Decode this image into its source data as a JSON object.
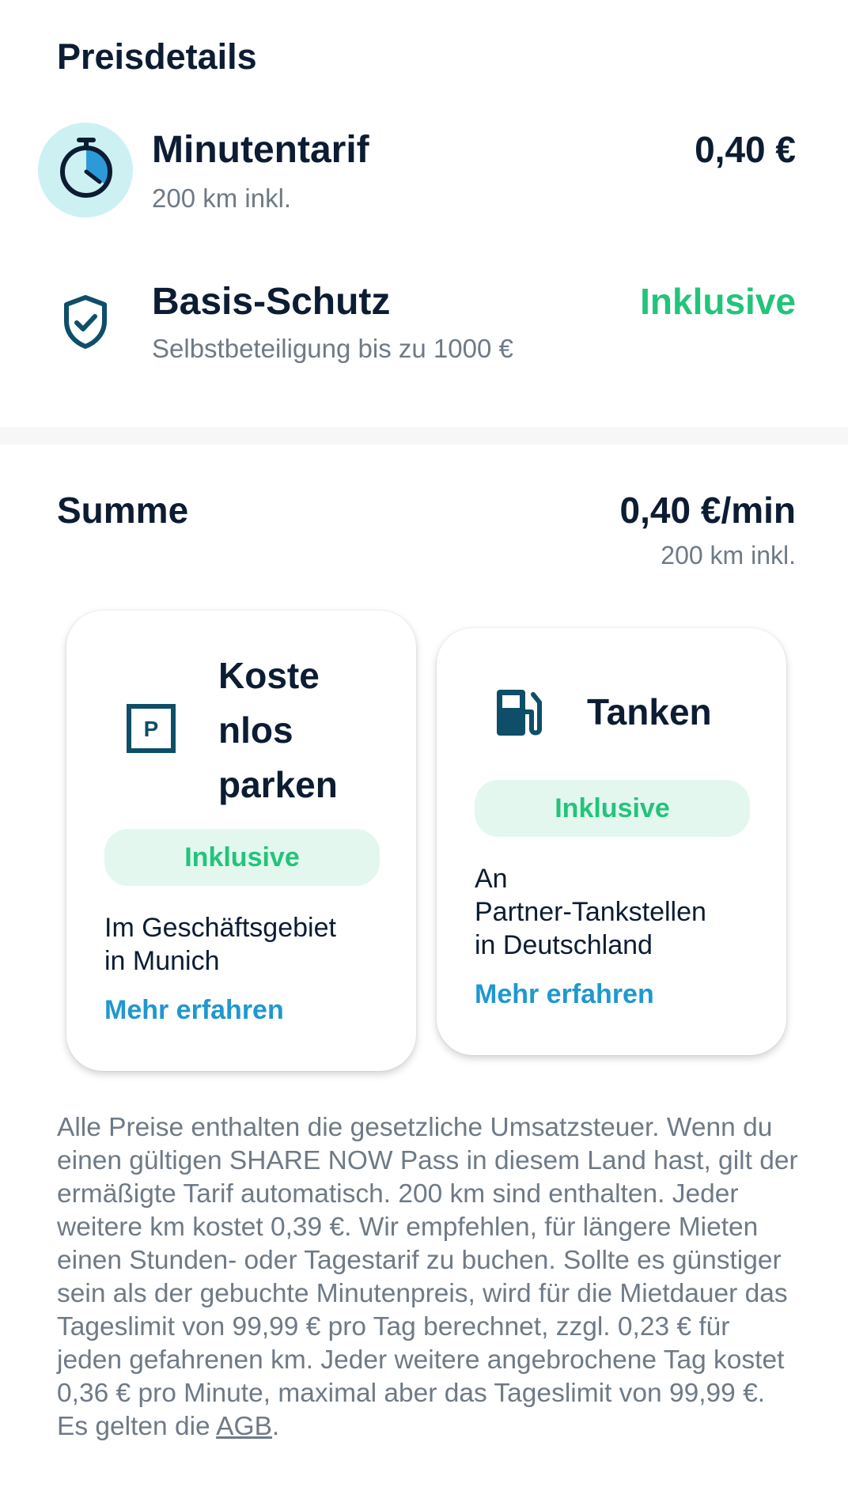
{
  "header": {
    "title": "Preisdetails"
  },
  "price_rows": [
    {
      "title": "Minutentarif",
      "subtitle": "200 km inkl.",
      "value": "0,40 €",
      "icon": "stopwatch-icon",
      "value_color": "#0c1c33"
    },
    {
      "title": "Basis-Schutz",
      "subtitle": "Selbstbeteiligung bis zu 1000 €",
      "value": "Inklusive",
      "icon": "shield-check-icon",
      "value_color": "#22c47a"
    }
  ],
  "summary": {
    "label": "Summe",
    "value": "0,40 €/min",
    "subtitle": "200 km inkl."
  },
  "cards": [
    {
      "title_lines": [
        "Koste",
        "nlos",
        "parken"
      ],
      "icon": "parking-icon",
      "badge": "Inklusive",
      "description_lines": [
        "Im Geschäftsgebiet",
        "in Munich"
      ],
      "link": "Mehr erfahren"
    },
    {
      "title_lines": [
        "Tanken"
      ],
      "icon": "fuel-pump-icon",
      "badge": "Inklusive",
      "description_lines": [
        "An",
        "Partner-Tankstellen",
        "in Deutschland"
      ],
      "link": "Mehr erfahren"
    }
  ],
  "disclaimer": {
    "text": "Alle Preise enthalten die gesetzliche Umsatzsteuer. Wenn du einen gültigen SHARE NOW Pass in diesem Land hast, gilt der ermäßigte Tarif automatisch. 200 km sind enthalten. Jeder weitere km kostet 0,39 €. Wir empfehlen, für längere Mieten einen Stunden- oder Tagestarif zu buchen. Sollte es günstiger sein als der gebuchte Minutenpreis, wird für die Mietdauer das Tageslimit von 99,99 € pro Tag berechnet, zzgl. 0,23 € für jeden gefahrenen km. Jeder weitere angebrochene Tag kostet 0,36 € pro Minute, maximal aber das Tageslimit von 99,99 €. Es gelten die",
    "link_text": "AGB",
    "suffix": "."
  },
  "colors": {
    "text_primary": "#0c1c33",
    "text_secondary": "#6e7a86",
    "accent_green": "#22c47a",
    "badge_bg": "#e3f7ef",
    "link_blue": "#1f98cf",
    "icon_teal": "#0e4e68",
    "icon_circle_bg": "#cdf1f2"
  }
}
